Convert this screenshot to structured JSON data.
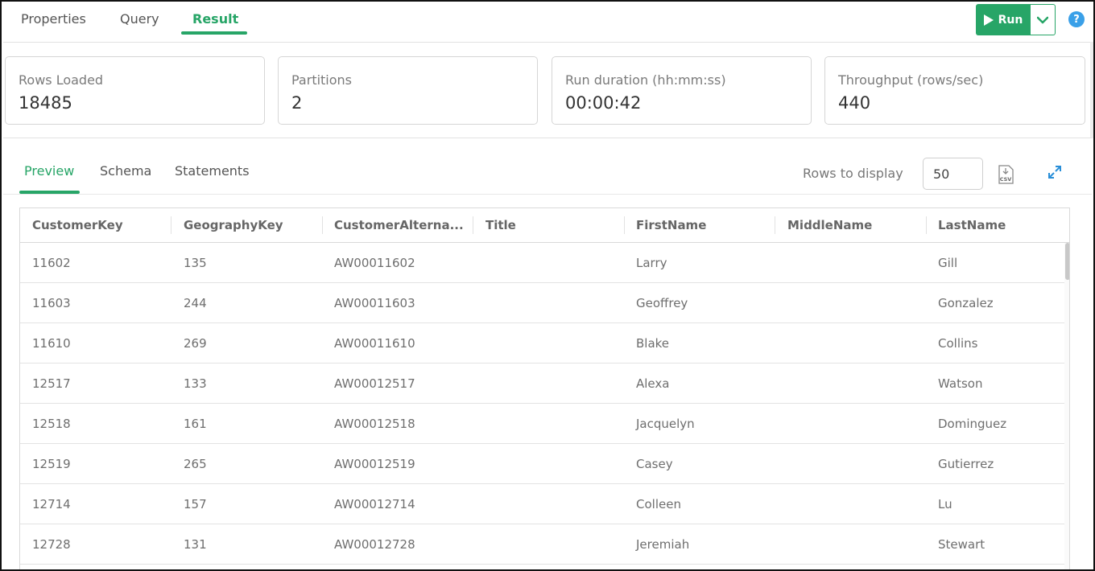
{
  "tabs": [
    {
      "label": "Properties"
    },
    {
      "label": "Query"
    },
    {
      "label": "Result"
    }
  ],
  "run_button": {
    "label": "Run"
  },
  "help": {
    "label": "?"
  },
  "stats": [
    {
      "label": "Rows Loaded",
      "value": "18485"
    },
    {
      "label": "Partitions",
      "value": "2"
    },
    {
      "label": "Run duration (hh:mm:ss)",
      "value": "00:00:42"
    },
    {
      "label": "Throughput (rows/sec)",
      "value": "440"
    }
  ],
  "subtabs": [
    {
      "label": "Preview"
    },
    {
      "label": "Schema"
    },
    {
      "label": "Statements"
    }
  ],
  "rows_to_display": {
    "label": "Rows to display",
    "value": "50"
  },
  "icons": {
    "csv": "csv-export-icon",
    "expand": "expand-icon",
    "run": "play-icon",
    "caret": "chevron-down-icon"
  },
  "colors": {
    "accent": "#27a567",
    "help": "#3aa0e8"
  },
  "table": {
    "columns": [
      "CustomerKey",
      "GeographyKey",
      "CustomerAlterna...",
      "Title",
      "FirstName",
      "MiddleName",
      "LastName"
    ],
    "rows": [
      [
        "11602",
        "135",
        "AW00011602",
        "",
        "Larry",
        "",
        "Gill"
      ],
      [
        "11603",
        "244",
        "AW00011603",
        "",
        "Geoffrey",
        "",
        "Gonzalez"
      ],
      [
        "11610",
        "269",
        "AW00011610",
        "",
        "Blake",
        "",
        "Collins"
      ],
      [
        "12517",
        "133",
        "AW00012517",
        "",
        "Alexa",
        "",
        "Watson"
      ],
      [
        "12518",
        "161",
        "AW00012518",
        "",
        "Jacquelyn",
        "",
        "Dominguez"
      ],
      [
        "12519",
        "265",
        "AW00012519",
        "",
        "Casey",
        "",
        "Gutierrez"
      ],
      [
        "12714",
        "157",
        "AW00012714",
        "",
        "Colleen",
        "",
        "Lu"
      ],
      [
        "12728",
        "131",
        "AW00012728",
        "",
        "Jeremiah",
        "",
        "Stewart"
      ]
    ]
  }
}
